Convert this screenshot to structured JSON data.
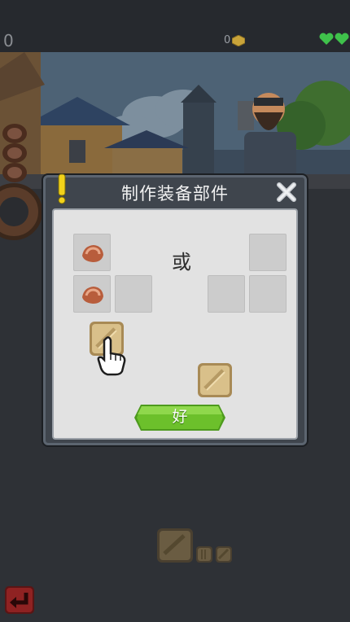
{
  "hud": {
    "left_count": "0",
    "coin_count": "0",
    "lives": 2
  },
  "dialog": {
    "title": "制作装备部件",
    "or_label": "或",
    "ok_label": "好"
  },
  "colors": {
    "ok_button": "#6cc02b",
    "heart": "#3fc24b",
    "coin": "#c9a43a",
    "alert": "#f2d21a"
  },
  "icons": [
    "ore-icon",
    "plank-icon",
    "pointer-hand-icon",
    "close-icon",
    "alert-icon",
    "coin-icon",
    "heart-icon",
    "back-arrow-icon"
  ]
}
